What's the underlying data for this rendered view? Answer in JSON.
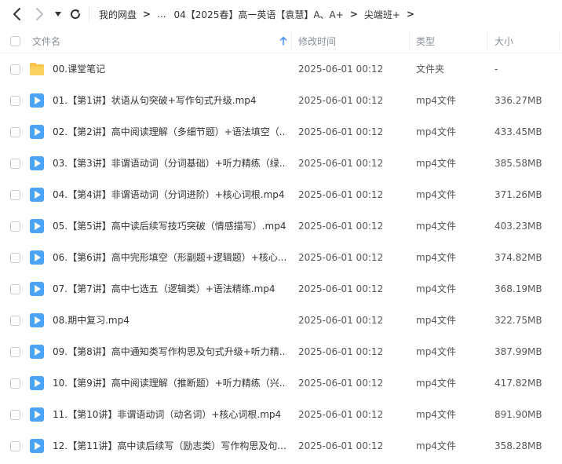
{
  "nav": {
    "back_icon": "chevron-left-icon",
    "forward_icon": "chevron-right-icon",
    "dropdown_icon": "caret-down-icon",
    "refresh_icon": "refresh-icon"
  },
  "breadcrumb": {
    "items": [
      "我的网盘",
      "...",
      "04【2025春】高一英语【袁慧】A、A+",
      "尖端班+"
    ],
    "separator": ">"
  },
  "table": {
    "columns": {
      "name": "文件名",
      "modified": "修改时间",
      "type": "类型",
      "size": "大小"
    },
    "sort_icon": "sort-ascending-arrow-icon",
    "rows": [
      {
        "name": "00.课堂笔记",
        "modified": "2025-06-01 00:12",
        "type": "文件夹",
        "size": "-",
        "icon": "folder-icon"
      },
      {
        "name": "01.【第1讲】状语从句突破+写作句式升级.mp4",
        "modified": "2025-06-01 00:12",
        "type": "mp4文件",
        "size": "336.27MB",
        "icon": "video-file-icon"
      },
      {
        "name": "02.【第2讲】高中阅读理解（多细节题）+语法填空（...",
        "modified": "2025-06-01 00:12",
        "type": "mp4文件",
        "size": "433.45MB",
        "icon": "video-file-icon"
      },
      {
        "name": "03.【第3讲】非谓语动词（分词基础）+听力精练（绿...",
        "modified": "2025-06-01 00:12",
        "type": "mp4文件",
        "size": "385.58MB",
        "icon": "video-file-icon"
      },
      {
        "name": "04.【第4讲】非谓语动词（分词进阶）+核心词根.mp4",
        "modified": "2025-06-01 00:12",
        "type": "mp4文件",
        "size": "371.26MB",
        "icon": "video-file-icon"
      },
      {
        "name": "05.【第5讲】高中读后续写技巧突破（情感描写）.mp4",
        "modified": "2025-06-01 00:12",
        "type": "mp4文件",
        "size": "403.23MB",
        "icon": "video-file-icon"
      },
      {
        "name": "06.【第6讲】高中完形填空（形副题+逻辑题）+核心...",
        "modified": "2025-06-01 00:12",
        "type": "mp4文件",
        "size": "374.82MB",
        "icon": "video-file-icon"
      },
      {
        "name": "07.【第7讲】高中七选五（逻辑类）+语法精练.mp4",
        "modified": "2025-06-01 00:12",
        "type": "mp4文件",
        "size": "368.19MB",
        "icon": "video-file-icon"
      },
      {
        "name": "08.期中复习.mp4",
        "modified": "2025-06-01 00:12",
        "type": "mp4文件",
        "size": "322.75MB",
        "icon": "video-file-icon"
      },
      {
        "name": "09.【第8讲】高中通知类写作构思及句式升级+听力精...",
        "modified": "2025-06-01 00:12",
        "type": "mp4文件",
        "size": "387.99MB",
        "icon": "video-file-icon"
      },
      {
        "name": "10.【第9讲】高中阅读理解（推断题）+听力精练（兴...",
        "modified": "2025-06-01 00:12",
        "type": "mp4文件",
        "size": "417.82MB",
        "icon": "video-file-icon"
      },
      {
        "name": "11.【第10讲】非谓语动词（动名词）+核心词根.mp4",
        "modified": "2025-06-01 00:12",
        "type": "mp4文件",
        "size": "891.90MB",
        "icon": "video-file-icon"
      },
      {
        "name": "12.【第11讲】高中读后续写（励志类）写作构思及句...",
        "modified": "2025-06-01 00:12",
        "type": "mp4文件",
        "size": "358.28MB",
        "icon": "video-file-icon"
      }
    ]
  },
  "colors": {
    "folder": "#f7c34b",
    "video": "#4aa3f5",
    "sort_arrow": "#3b8cff"
  }
}
